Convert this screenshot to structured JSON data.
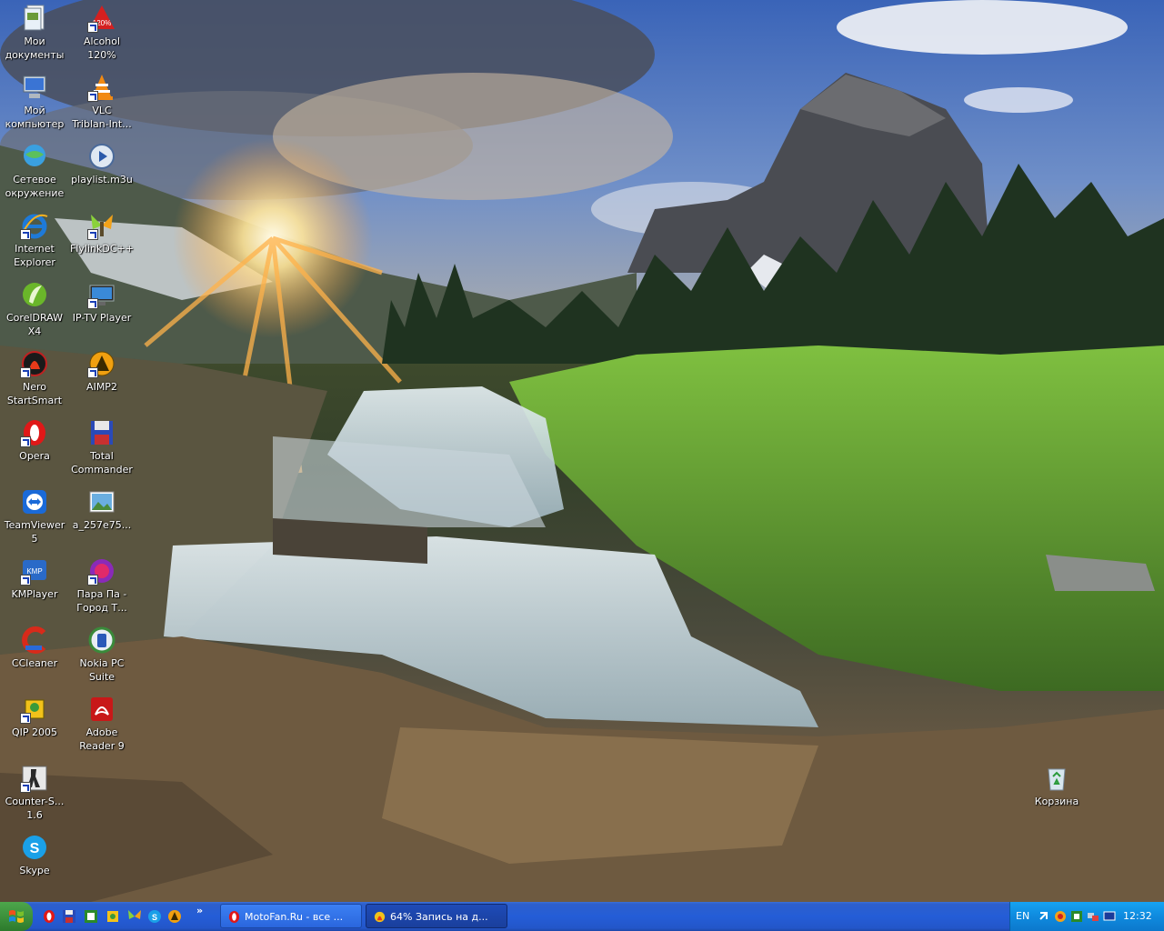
{
  "desktop": {
    "icons": [
      {
        "label": "Мои\nдокументы",
        "icon": "my-documents-icon"
      },
      {
        "label": "Alcohol\n120%",
        "icon": "alcohol-icon"
      },
      {
        "label": "Мой\nкомпьютер",
        "icon": "my-computer-icon"
      },
      {
        "label": "VLC\nTriblan-Int...",
        "icon": "vlc-icon"
      },
      {
        "label": "Сетевое\nокружение",
        "icon": "network-icon"
      },
      {
        "label": "playlist.m3u",
        "icon": "playlist-icon"
      },
      {
        "label": "Internet\nExplorer",
        "icon": "internet-explorer-icon"
      },
      {
        "label": "FlylinkDC++",
        "icon": "flylinkdc-icon"
      },
      {
        "label": "CorelDRAW\nX4",
        "icon": "coreldraw-icon"
      },
      {
        "label": "IP-TV Player",
        "icon": "iptv-player-icon"
      },
      {
        "label": "Nero\nStartSmart",
        "icon": "nero-icon"
      },
      {
        "label": "AIMP2",
        "icon": "aimp-icon"
      },
      {
        "label": "Opera",
        "icon": "opera-icon"
      },
      {
        "label": "Total\nCommander",
        "icon": "total-commander-icon"
      },
      {
        "label": "TeamViewer\n5",
        "icon": "teamviewer-icon"
      },
      {
        "label": "a_257e75...",
        "icon": "image-file-icon"
      },
      {
        "label": "KMPlayer",
        "icon": "kmplayer-icon"
      },
      {
        "label": "Пара Па -\nГород Т...",
        "icon": "media-file-icon"
      },
      {
        "label": "CCleaner",
        "icon": "ccleaner-icon"
      },
      {
        "label": "Nokia PC\nSuite",
        "icon": "nokia-pc-suite-icon"
      },
      {
        "label": "QIP 2005",
        "icon": "qip-icon"
      },
      {
        "label": "Adobe\nReader 9",
        "icon": "adobe-reader-icon"
      },
      {
        "label": "Counter-S...\n1.6",
        "icon": "counter-strike-icon"
      },
      {
        "label": "Skype",
        "icon": "skype-icon"
      }
    ],
    "recycle_bin": {
      "label": "Корзина",
      "icon": "recycle-bin-icon"
    }
  },
  "taskbar": {
    "tasks": [
      {
        "label": "MotoFan.Ru - все ...",
        "icon": "opera-icon"
      },
      {
        "label": "64% Запись на д...",
        "icon": "nero-burn-icon"
      }
    ],
    "quick_launch_more": "»",
    "tray": {
      "language": "EN",
      "clock": "12:32"
    }
  }
}
